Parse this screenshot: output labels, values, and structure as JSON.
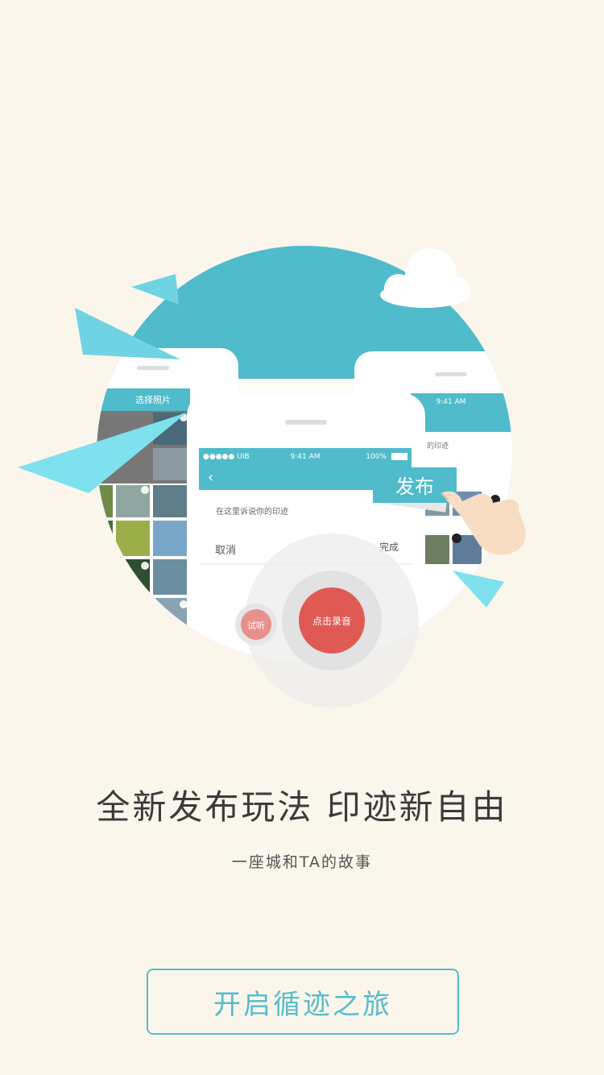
{
  "colors": {
    "background": "#FAF6EC",
    "accent": "#56BCCB",
    "teal_circle": "#4FBBCB",
    "record_red": "#E05A55",
    "headline": "#3b3b3b"
  },
  "illustration": {
    "left_phone": {
      "header": "选择照片"
    },
    "right_phone": {
      "status_time": "9:41 AM",
      "text_fragment": "的印迹"
    },
    "center_phone": {
      "status_carrier": "●●●●● UIB",
      "status_time": "9:41 AM",
      "status_battery": "100%",
      "input_placeholder": "在这里诉说你的印迹",
      "cancel_label": "取消",
      "done_label": "完成"
    },
    "publish_label": "发布",
    "preview_label": "试听",
    "record_label": "点击录音"
  },
  "headline": "全新发布玩法 印迹新自由",
  "subtitle": "一座城和TA的故事",
  "start_button": "开启循迹之旅"
}
